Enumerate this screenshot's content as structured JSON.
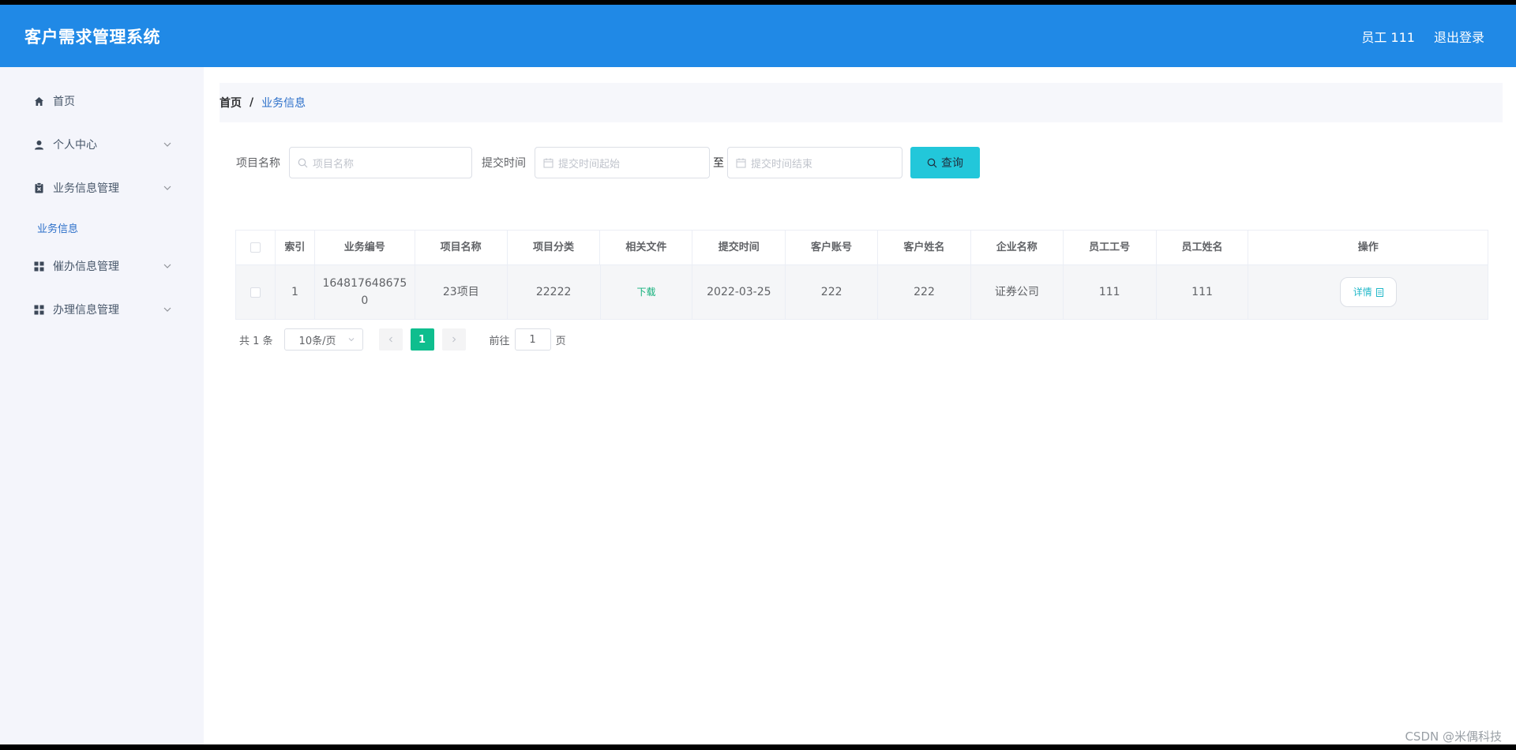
{
  "header": {
    "title": "客户需求管理系统",
    "user": "员工 111",
    "logout": "退出登录"
  },
  "sidebar": {
    "items": [
      {
        "label": "首页"
      },
      {
        "label": "个人中心"
      },
      {
        "label": "业务信息管理"
      },
      {
        "label": "催办信息管理"
      },
      {
        "label": "办理信息管理"
      }
    ],
    "sub_active": "业务信息"
  },
  "breadcrumb": {
    "home": "首页",
    "sep": "/",
    "current": "业务信息"
  },
  "search": {
    "project_label": "项目名称",
    "project_placeholder": "项目名称",
    "time_label": "提交时间",
    "start_placeholder": "提交时间起始",
    "to": "至",
    "end_placeholder": "提交时间结束",
    "button": "查询"
  },
  "table": {
    "headers": [
      "",
      "索引",
      "业务编号",
      "项目名称",
      "项目分类",
      "相关文件",
      "提交时间",
      "客户账号",
      "客户姓名",
      "企业名称",
      "员工工号",
      "员工姓名",
      "操作"
    ],
    "rows": [
      {
        "index": "1",
        "code": "164817648675 0",
        "name": "23项目",
        "category": "22222",
        "file": "下载",
        "time": "2022-03-25",
        "account": "222",
        "customer": "222",
        "company": "证券公司",
        "staff_no": "111",
        "staff_name": "111",
        "action": "详情"
      }
    ]
  },
  "pager": {
    "total": "共 1 条",
    "size": "10条/页",
    "current": "1",
    "goto_label": "前往",
    "goto_value": "1",
    "page_suffix": "页"
  },
  "watermark": "CSDN @米偶科技"
}
